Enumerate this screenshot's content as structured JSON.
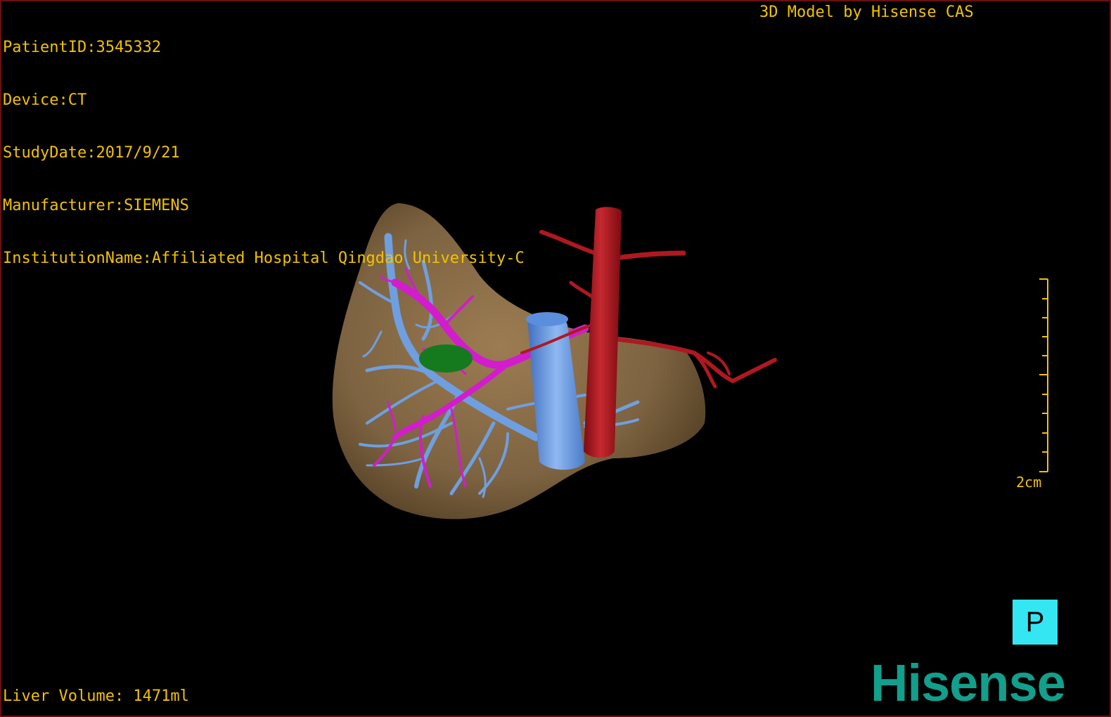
{
  "patient_info": {
    "patient_id": "PatientID:3545332",
    "device": "Device:CT",
    "study_date": "StudyDate:2017/9/21",
    "manufacturer": "Manufacturer:SIEMENS",
    "institution": "InstitutionName:Affiliated Hospital Qingdao University-C"
  },
  "credit": "3D Model by Hisense CAS",
  "liver_volume": "Liver Volume: 1471ml",
  "scale": {
    "label": "2cm"
  },
  "orientation": {
    "label": "P"
  },
  "brand": "Hisense",
  "colors": {
    "overlay_text": "#f2c200",
    "liver": "#7d6341",
    "hepatic_vein": "#6f9fe0",
    "portal_vein": "#d21ccd",
    "artery_aorta": "#b01820",
    "ivc": "#5b8fde",
    "lesion": "#157a1e",
    "orientation_bg": "#34e6f2",
    "brand": "#129f8c"
  },
  "icons": {
    "orientation": "orientation-cube-icon",
    "scale": "scale-ruler-icon"
  }
}
